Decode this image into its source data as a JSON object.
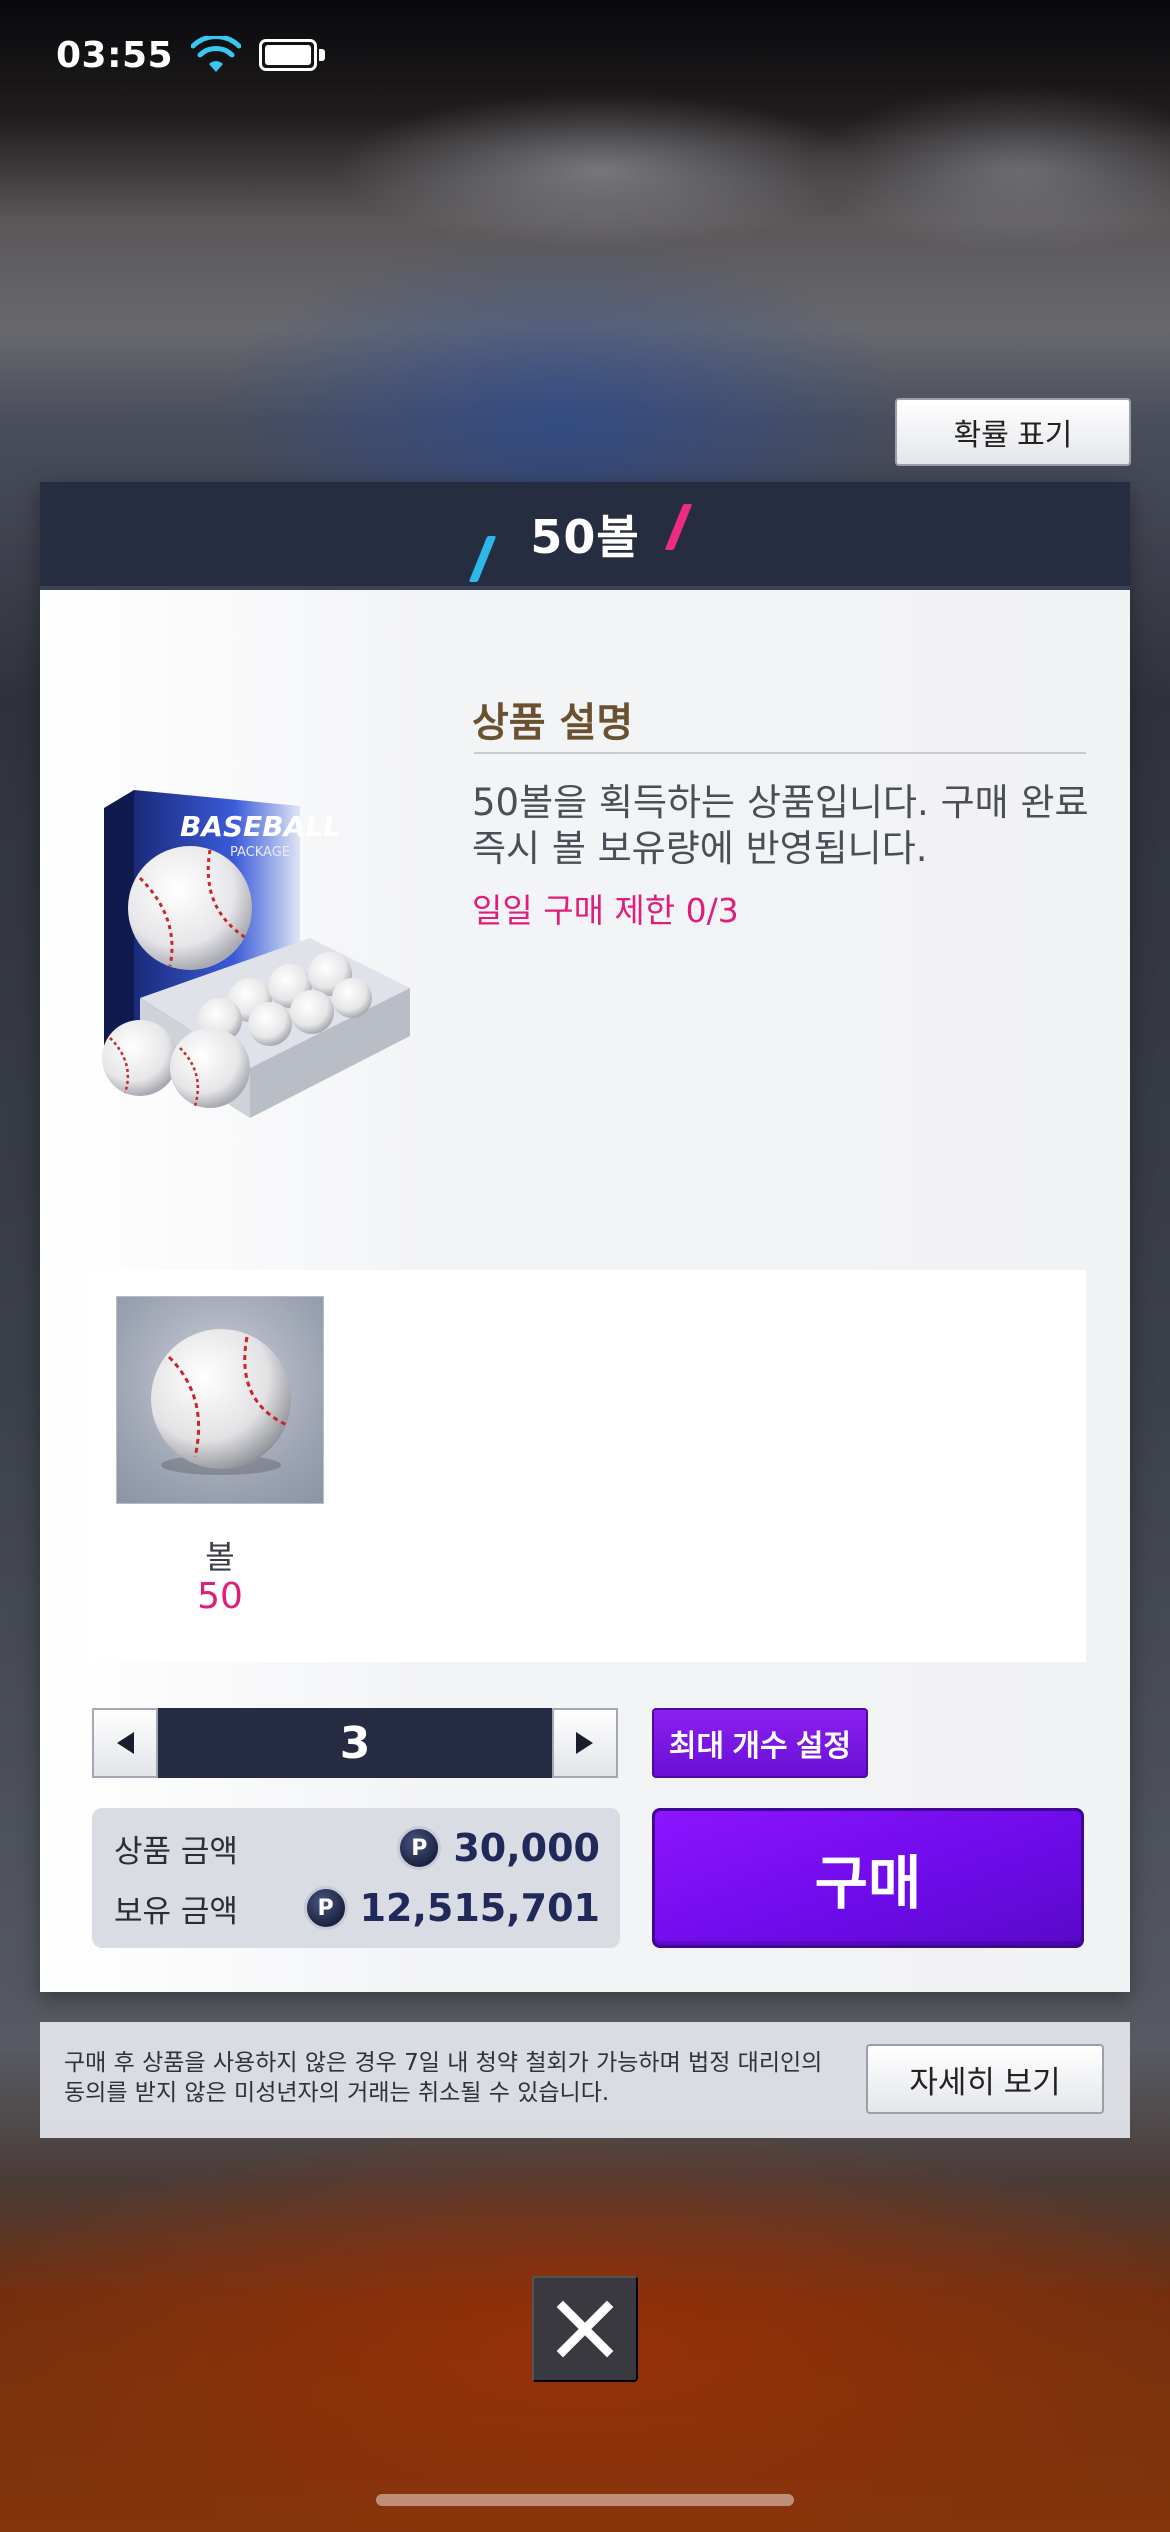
{
  "status_bar": {
    "time": "03:55"
  },
  "probability_button": "확률 표기",
  "panel": {
    "title": "50볼",
    "desc_heading": "상품 설명",
    "description": "50볼을 획득하는 상품입니다. 구매 완료 즉시 볼 보유량에 반영됩니다.",
    "daily_limit": "일일 구매 제한 0/3",
    "product_box": {
      "brand": "BASEBALL",
      "sub": "PACKAGE"
    },
    "reward": {
      "name": "볼",
      "count": "50"
    },
    "quantity": "3",
    "max_button": "최대 개수 설정",
    "price_label": "상품 금액",
    "price_value": "30,000",
    "owned_label": "보유 금액",
    "owned_value": "12,515,701",
    "coin_symbol": "P",
    "buy_button": "구매"
  },
  "notice": {
    "text": "구매 후 상품을 사용하지 않은 경우 7일 내 청약 철회가 가능하며 법정 대리인의 동의를 받지 않은 미성년자의 거래는 취소될 수 있습니다.",
    "detail_button": "자세히 보기"
  },
  "icons": {
    "wifi": "wifi-icon",
    "battery": "battery-icon",
    "left_arrow": "arrow-left-icon",
    "right_arrow": "arrow-right-icon",
    "close": "close-icon",
    "coin": "p-coin-icon",
    "baseball": "baseball-icon"
  },
  "colors": {
    "header_bg": "#272d40",
    "accent_purple": "#7a10f0",
    "limit_pink": "#e01c7c",
    "heading_brown": "#6a5230",
    "slash_blue": "#2bb7e8",
    "slash_pink": "#ee2a86"
  }
}
